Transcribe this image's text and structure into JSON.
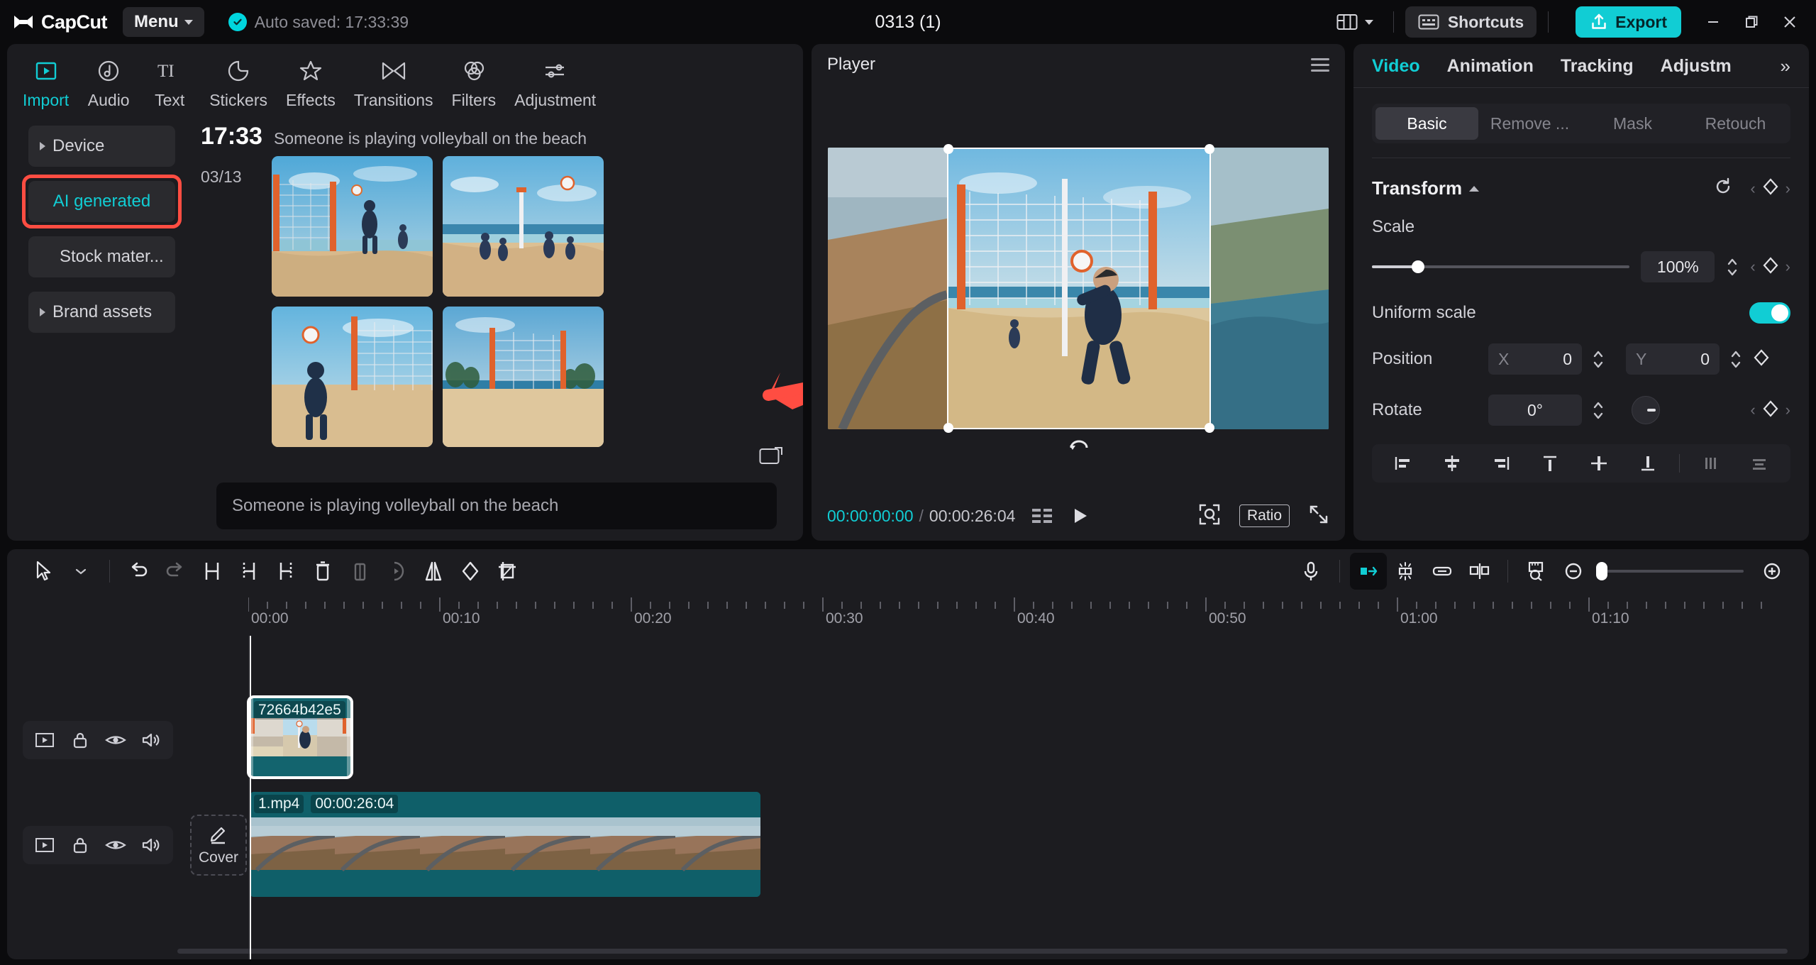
{
  "app": {
    "name": "CapCut",
    "menu_label": "Menu",
    "autosave_text": "Auto saved: 17:33:39",
    "project_title": "0313 (1)",
    "shortcuts_label": "Shortcuts",
    "export_label": "Export",
    "accent": "#11cdd4",
    "highlight": "#ff4d42"
  },
  "toolbar_tabs": [
    {
      "label": "Import",
      "icon": "import-icon",
      "active": true
    },
    {
      "label": "Audio",
      "icon": "audio-icon",
      "active": false
    },
    {
      "label": "Text",
      "icon": "text-icon",
      "active": false
    },
    {
      "label": "Stickers",
      "icon": "stickers-icon",
      "active": false
    },
    {
      "label": "Effects",
      "icon": "effects-icon",
      "active": false
    },
    {
      "label": "Transitions",
      "icon": "transitions-icon",
      "active": false
    },
    {
      "label": "Filters",
      "icon": "filters-icon",
      "active": false
    },
    {
      "label": "Adjustment",
      "icon": "adjustment-icon",
      "active": false
    }
  ],
  "media_sidebar": [
    {
      "label": "Device",
      "expandable": true,
      "highlighted": false
    },
    {
      "label": "AI generated",
      "expandable": false,
      "highlighted": true
    },
    {
      "label": "Stock mater...",
      "expandable": false,
      "highlighted": false
    },
    {
      "label": "Brand assets",
      "expandable": true,
      "highlighted": false
    }
  ],
  "media": {
    "group_time": "17:33",
    "group_prompt": "Someone is playing volleyball on the beach",
    "group_date": "03/13",
    "prompt_box_text": "Someone is playing volleyball on the beach",
    "thumb_count": 4
  },
  "player": {
    "title": "Player",
    "current_time": "00:00:00:00",
    "separator": "/",
    "total_time": "00:00:26:04",
    "ratio_label": "Ratio",
    "icons": [
      "list-icon",
      "play-icon",
      "snapshot-icon",
      "fullscreen-icon",
      "menu-icon"
    ]
  },
  "attributes": {
    "tabs": [
      {
        "label": "Video",
        "active": true
      },
      {
        "label": "Animation",
        "active": false
      },
      {
        "label": "Tracking",
        "active": false
      },
      {
        "label": "Adjustm",
        "active": false
      }
    ],
    "more_label": "»",
    "segments": [
      {
        "label": "Basic",
        "active": true
      },
      {
        "label": "Remove ...",
        "active": false
      },
      {
        "label": "Mask",
        "active": false
      },
      {
        "label": "Retouch",
        "active": false
      }
    ],
    "transform": {
      "title": "Transform",
      "scale_label": "Scale",
      "scale_value": "100%",
      "uniform_label": "Uniform scale",
      "uniform_on": true,
      "position_label": "Position",
      "position_x_axis": "X",
      "position_x": "0",
      "position_y_axis": "Y",
      "position_y": "0",
      "rotate_label": "Rotate",
      "rotate_value": "0°"
    },
    "align_icons": [
      "align-left-icon",
      "align-center-h-icon",
      "align-right-icon",
      "align-top-icon",
      "align-middle-v-icon",
      "align-bottom-icon",
      "distribute-h-icon",
      "distribute-v-icon"
    ]
  },
  "timeline": {
    "tools": [
      {
        "name": "select-icon",
        "disabled": false
      },
      {
        "name": "chevron-down-icon",
        "disabled": false
      },
      {
        "name": "undo-icon",
        "disabled": false
      },
      {
        "name": "redo-icon",
        "disabled": true
      },
      {
        "name": "split-icon",
        "disabled": false
      },
      {
        "name": "trim-left-icon",
        "disabled": false
      },
      {
        "name": "trim-right-icon",
        "disabled": false
      },
      {
        "name": "delete-icon",
        "disabled": false
      },
      {
        "name": "freeze-icon",
        "disabled": true
      },
      {
        "name": "reverse-icon",
        "disabled": true
      },
      {
        "name": "mirror-icon",
        "disabled": false
      },
      {
        "name": "rotate-icon",
        "disabled": false
      },
      {
        "name": "crop-icon",
        "disabled": false
      }
    ],
    "right_tools": [
      {
        "name": "record-icon",
        "active": false
      },
      {
        "name": "snap-icon",
        "active": true
      },
      {
        "name": "auto-gap-icon",
        "active": false
      },
      {
        "name": "link-icon",
        "active": false
      },
      {
        "name": "adsorb-icon",
        "active": false
      },
      {
        "name": "fit-timeline-icon",
        "active": false
      },
      {
        "name": "zoom-out-icon",
        "active": false
      },
      {
        "name": "zoom-in-icon",
        "active": false
      }
    ],
    "ruler_ticks": [
      "00:00",
      "00:10",
      "00:20",
      "00:30",
      "00:40",
      "00:50",
      "01:00",
      "01:10"
    ],
    "tracks": [
      {
        "controls": [
          "track-thumb-icon",
          "lock-icon",
          "eye-icon",
          "volume-icon"
        ],
        "clip": {
          "name": "72664b42e5",
          "duration": "",
          "selected": true
        }
      },
      {
        "controls": [
          "track-thumb-icon",
          "lock-icon",
          "eye-icon",
          "volume-icon"
        ],
        "cover_label": "Cover",
        "clip": {
          "name": "1.mp4",
          "duration": "00:00:26:04",
          "selected": false
        }
      }
    ]
  }
}
